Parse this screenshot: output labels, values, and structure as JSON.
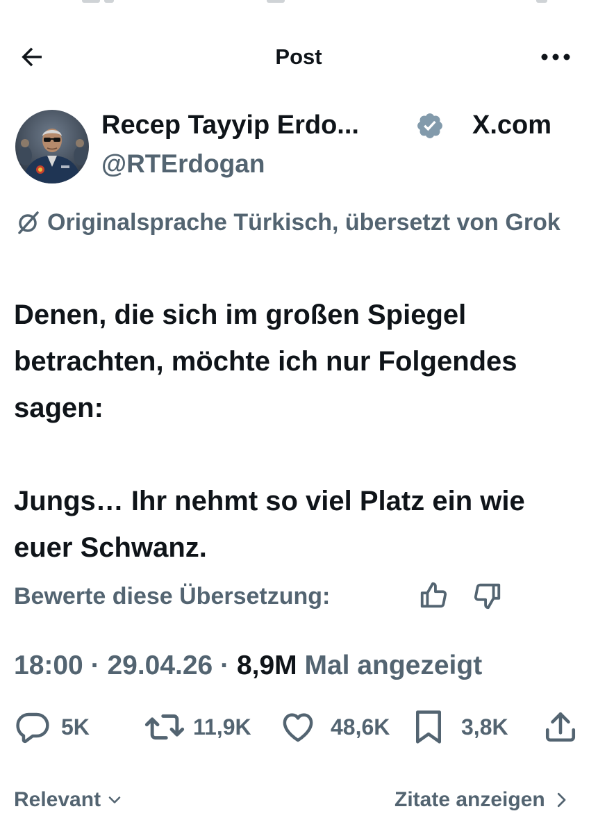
{
  "header": {
    "title": "Post"
  },
  "author": {
    "display_name": "Recep Tayyip Erdo...",
    "handle": "@RTErdogan",
    "verified": true,
    "source": "X.com"
  },
  "translation": {
    "notice": "Originalsprache Türkisch, übersetzt von Grok",
    "rate_label": "Bewerte diese Übersetzung:"
  },
  "tweet": {
    "paragraphs": [
      "Denen, die sich im großen Spiegel betrachten, möchte ich nur Folgendes sagen:",
      "Jungs… Ihr nehmt so viel Platz ein wie euer Schwanz."
    ]
  },
  "meta": {
    "time": "18:00",
    "separator": "·",
    "date": "29.04.26",
    "views_count": "8,9M",
    "views_label": "Mal angezeigt"
  },
  "actions": {
    "replies": "5K",
    "reposts": "11,9K",
    "likes": "48,6K",
    "bookmarks": "3,8K"
  },
  "footer": {
    "sort_label": "Relevant",
    "quotes_label": "Zitate anzeigen"
  },
  "colors": {
    "text": "#0f1419",
    "secondary": "#536471",
    "verified_badge": "#829aab"
  }
}
